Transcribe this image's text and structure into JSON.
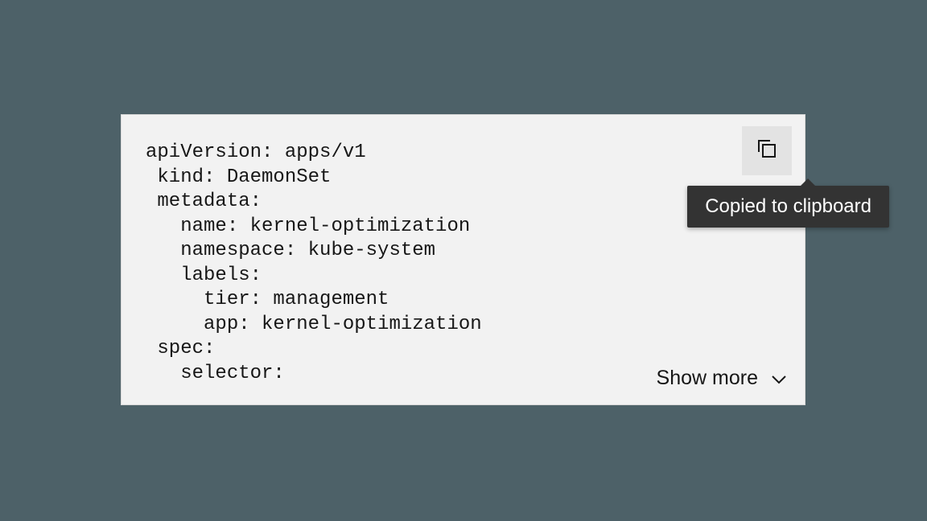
{
  "code": {
    "text": "apiVersion: apps/v1\n kind: DaemonSet\n metadata:\n   name: kernel-optimization\n   namespace: kube-system\n   labels:\n     tier: management\n     app: kernel-optimization\n spec:\n   selector:"
  },
  "tooltip": {
    "text": "Copied to clipboard"
  },
  "showMore": {
    "label": "Show more"
  }
}
